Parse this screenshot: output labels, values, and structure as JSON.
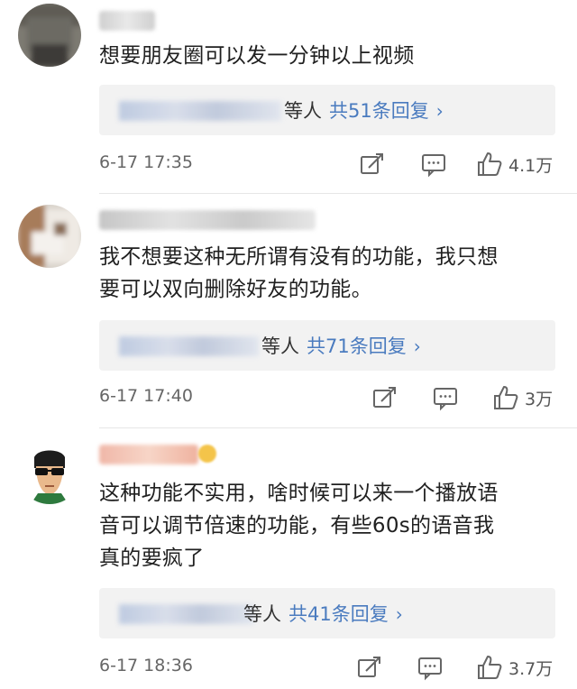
{
  "comments": [
    {
      "avatar_icon": "user-avatar-icon",
      "text_lines": [
        "想要朋友圈可以发一分钟以上视频"
      ],
      "reply_suffix": "等人",
      "reply_link": "共51条回复",
      "chevron": "›",
      "time": "6-17 17:35",
      "likes": "4.1万"
    },
    {
      "avatar_icon": "user-avatar-icon",
      "text_lines": [
        "我不想要这种无所谓有没有的功能，我只想",
        "要可以双向删除好友的功能。"
      ],
      "reply_suffix": "等人",
      "reply_link": "共71条回复",
      "chevron": "›",
      "time": "6-17 17:40",
      "likes": "3万"
    },
    {
      "avatar_icon": "user-avatar-icon",
      "text_lines": [
        "这种功能不实用，啥时候可以来一个播放语",
        "音可以调节倍速的功能，有些60s的语音我",
        "真的要疯了"
      ],
      "reply_suffix": "等人",
      "reply_link": "共41条回复",
      "chevron": "›",
      "time": "6-17 18:36",
      "likes": "3.7万"
    }
  ],
  "icons": {
    "repost": "repost-icon",
    "comment": "comment-icon",
    "like": "like-icon"
  },
  "colors": {
    "link": "#4a7bbf",
    "text": "#202020",
    "meta": "#666666",
    "reply_bg": "#f2f2f2"
  }
}
